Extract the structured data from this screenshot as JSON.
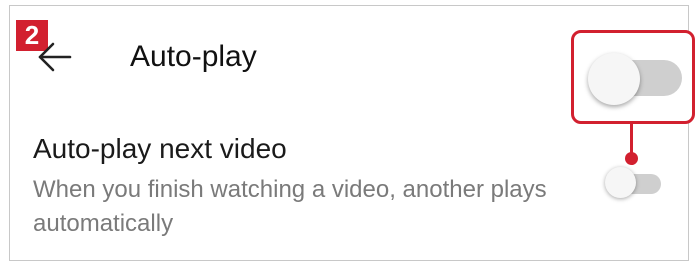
{
  "step_badge": "2",
  "header": {
    "back_icon": "arrow-left-icon",
    "title": "Auto-play"
  },
  "setting": {
    "title": "Auto-play next video",
    "description": "When you finish watching a video, another plays automatically",
    "toggle_state": "off"
  },
  "callout": {
    "toggle_state": "off"
  },
  "colors": {
    "accent": "#d2202f",
    "toggle_track_off": "#cfcfcf",
    "toggle_knob": "#f6f6f6",
    "title_text": "#111111",
    "description_text": "#7a7a7a"
  }
}
